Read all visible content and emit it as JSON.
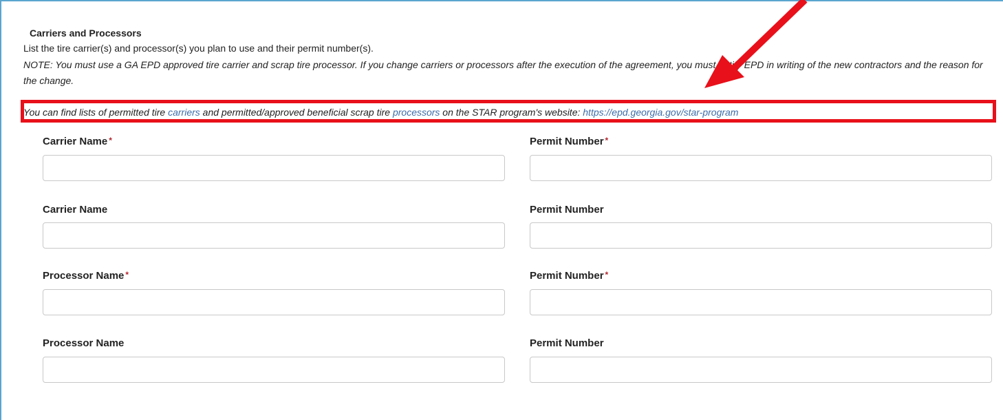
{
  "section": {
    "title": "Carriers and Processors",
    "instructions": "List the tire carrier(s) and processor(s) you plan to use and their permit number(s).",
    "note": "NOTE: You must use a GA EPD approved tire carrier and scrap tire processor. If you change carriers or processors after the execution of the agreement, you must notify EPD in writing of the new contractors and the reason for the change.",
    "links_line": {
      "part1": "You can find lists of permitted tire ",
      "link_carriers": "carriers",
      "part2": " and permitted/approved beneficial scrap tire ",
      "link_processors": "processors",
      "part3": " on the STAR program's website: ",
      "link_url": "https://epd.georgia.gov/star-program"
    }
  },
  "fields": {
    "carrier1": {
      "label": "Carrier Name",
      "required_mark": "*",
      "value": ""
    },
    "permit1": {
      "label": "Permit Number",
      "required_mark": "*",
      "value": ""
    },
    "carrier2": {
      "label": "Carrier Name",
      "value": ""
    },
    "permit2": {
      "label": "Permit Number",
      "value": ""
    },
    "processor1": {
      "label": "Processor Name",
      "required_mark": "*",
      "value": ""
    },
    "permit3": {
      "label": "Permit Number",
      "required_mark": "*",
      "value": ""
    },
    "processor2": {
      "label": "Processor Name",
      "value": ""
    },
    "permit4": {
      "label": "Permit Number",
      "value": ""
    }
  },
  "annotation": {
    "highlight_color": "#e8101a"
  },
  "colors": {
    "panel_border": "#5aa6cf",
    "link": "#3d6da8",
    "required": "#b3262e"
  }
}
